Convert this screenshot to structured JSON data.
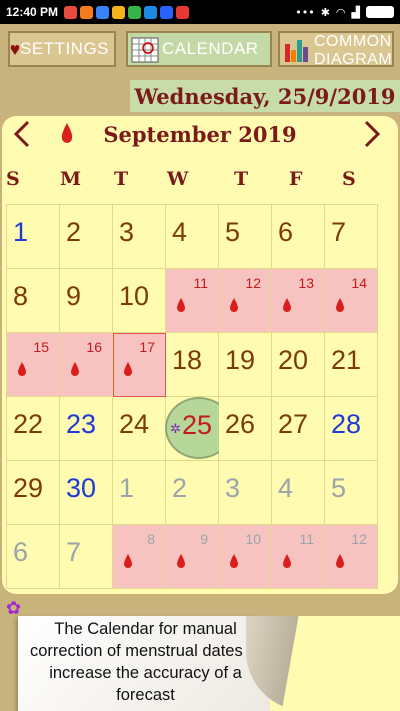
{
  "status": {
    "time": "12:40 PM"
  },
  "tabs": [
    {
      "label": "SETTINGS",
      "icon": "heart-icon"
    },
    {
      "label": "CALENDAR",
      "icon": "calendar-icon"
    },
    {
      "label": "COMMON DIAGRAM",
      "icon": "bar-chart-icon"
    }
  ],
  "header": {
    "date": "Wednesday, 25/9/2019"
  },
  "calendar": {
    "month_title": "September 2019",
    "prev_label": "〈",
    "next_label": "〉",
    "weekdays": [
      "S",
      "M",
      "T",
      "W",
      "T",
      "F",
      "S"
    ],
    "today": "25",
    "cells": [
      {
        "d": "1",
        "t": "blue"
      },
      {
        "d": "2",
        "t": "normal"
      },
      {
        "d": "3",
        "t": "normal"
      },
      {
        "d": "4",
        "t": "normal"
      },
      {
        "d": "5",
        "t": "normal"
      },
      {
        "d": "6",
        "t": "normal"
      },
      {
        "d": "7",
        "t": "normal"
      },
      {
        "d": "8",
        "t": "normal"
      },
      {
        "d": "9",
        "t": "normal"
      },
      {
        "d": "10",
        "t": "normal"
      },
      {
        "d": "11",
        "t": "period"
      },
      {
        "d": "12",
        "t": "period"
      },
      {
        "d": "13",
        "t": "period"
      },
      {
        "d": "14",
        "t": "period"
      },
      {
        "d": "15",
        "t": "period"
      },
      {
        "d": "16",
        "t": "period"
      },
      {
        "d": "17",
        "t": "period-marked"
      },
      {
        "d": "18",
        "t": "normal"
      },
      {
        "d": "19",
        "t": "normal"
      },
      {
        "d": "20",
        "t": "normal"
      },
      {
        "d": "21",
        "t": "normal"
      },
      {
        "d": "22",
        "t": "normal"
      },
      {
        "d": "23",
        "t": "blue"
      },
      {
        "d": "24",
        "t": "normal"
      },
      {
        "d": "25",
        "t": "today"
      },
      {
        "d": "26",
        "t": "normal"
      },
      {
        "d": "27",
        "t": "normal"
      },
      {
        "d": "28",
        "t": "blue"
      },
      {
        "d": "29",
        "t": "normal"
      },
      {
        "d": "30",
        "t": "blue"
      },
      {
        "d": "1",
        "t": "grey"
      },
      {
        "d": "2",
        "t": "grey"
      },
      {
        "d": "3",
        "t": "grey"
      },
      {
        "d": "4",
        "t": "grey"
      },
      {
        "d": "5",
        "t": "grey"
      },
      {
        "d": "6",
        "t": "grey"
      },
      {
        "d": "7",
        "t": "grey"
      },
      {
        "d": "8",
        "t": "period-grey"
      },
      {
        "d": "9",
        "t": "period-grey"
      },
      {
        "d": "10",
        "t": "period-grey"
      },
      {
        "d": "11",
        "t": "period-grey"
      },
      {
        "d": "12",
        "t": "period-grey"
      }
    ]
  },
  "note": {
    "text": "The Calendar for manual correction of menstrual dates to increase the accuracy of  a forecast"
  },
  "colors": {
    "period": "#f7c3c0",
    "accent": "#7b1a1a",
    "today_circle": "#b7d69a",
    "blue_day": "#1f3bd6"
  }
}
